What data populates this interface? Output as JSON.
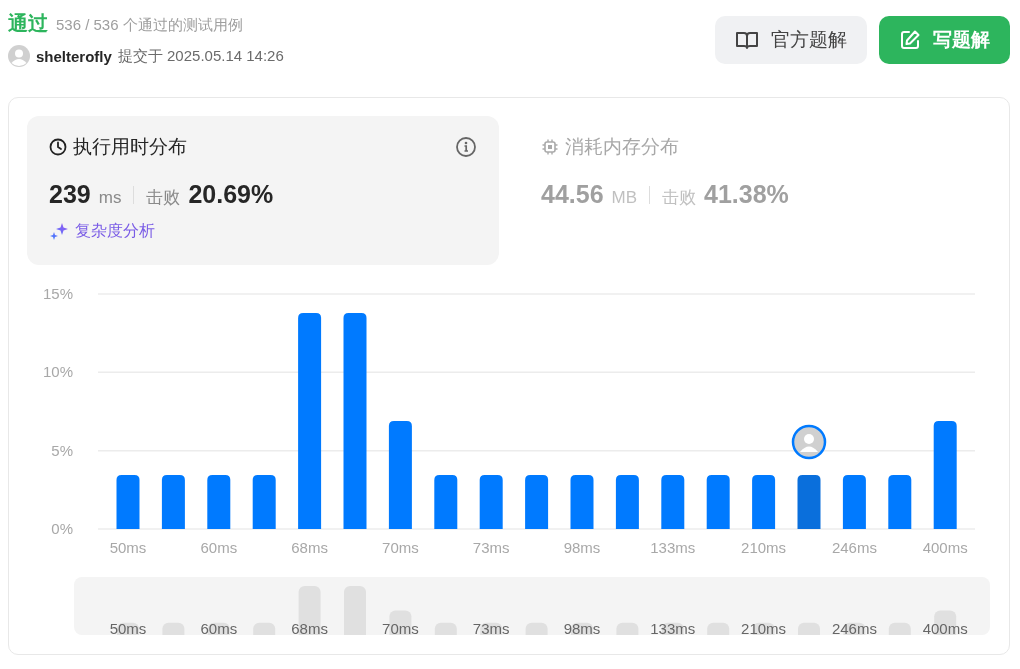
{
  "result": {
    "status": "通过",
    "cases": "536 / 536 个通过的测试用例",
    "user": "shelterofly",
    "submitted": "提交于 2025.05.14 14:26"
  },
  "buttons": [
    {
      "kind": "secondary",
      "label": "官方题解"
    },
    {
      "kind": "primary",
      "label": "写题解"
    }
  ],
  "stats": [
    {
      "kind": "time",
      "title": "执行用时分布",
      "selected": true,
      "value": "239",
      "unit": "ms",
      "beat_label": "击败",
      "beat": "20.69%",
      "link": "复杂度分析"
    },
    {
      "kind": "memory",
      "title": "消耗内存分布",
      "selected": false,
      "value": "44.56",
      "unit": "MB",
      "beat_label": "击败",
      "beat": "41.38%"
    }
  ],
  "chart": {
    "bars": [
      {
        "selected": false
      },
      {
        "selected": false
      },
      {
        "selected": false
      },
      {
        "selected": false
      },
      {
        "selected": false
      },
      {
        "selected": false
      },
      {
        "selected": false
      },
      {
        "selected": false
      },
      {
        "selected": false
      },
      {
        "selected": false
      },
      {
        "selected": false
      },
      {
        "selected": false
      },
      {
        "selected": false
      },
      {
        "selected": false
      },
      {
        "selected": false
      },
      {
        "selected": true
      },
      {
        "selected": false
      },
      {
        "selected": false
      },
      {
        "selected": false
      }
    ],
    "chart_data": {
      "type": "bar",
      "categories": [
        "50ms",
        null,
        "60ms",
        null,
        "68ms",
        null,
        "70ms",
        null,
        "73ms",
        null,
        "98ms",
        null,
        "133ms",
        null,
        "210ms",
        null,
        "246ms",
        null,
        "400ms"
      ],
      "values": [
        3.45,
        3.45,
        3.45,
        3.45,
        13.79,
        13.79,
        6.9,
        3.45,
        3.45,
        3.45,
        3.45,
        3.45,
        3.45,
        3.45,
        3.45,
        3.45,
        3.45,
        3.45,
        6.9
      ],
      "yticks": [
        {
          "value": 0,
          "label": "0%"
        },
        {
          "value": 5,
          "label": "5%"
        },
        {
          "value": 10,
          "label": "10%"
        },
        {
          "value": 15,
          "label": "15%"
        }
      ],
      "ylim": [
        0,
        15
      ]
    }
  },
  "overview": {
    "labels": [
      "50ms",
      "60ms",
      "68ms",
      "70ms",
      "73ms",
      "98ms",
      "133ms",
      "210ms",
      "246ms",
      "400ms"
    ]
  }
}
